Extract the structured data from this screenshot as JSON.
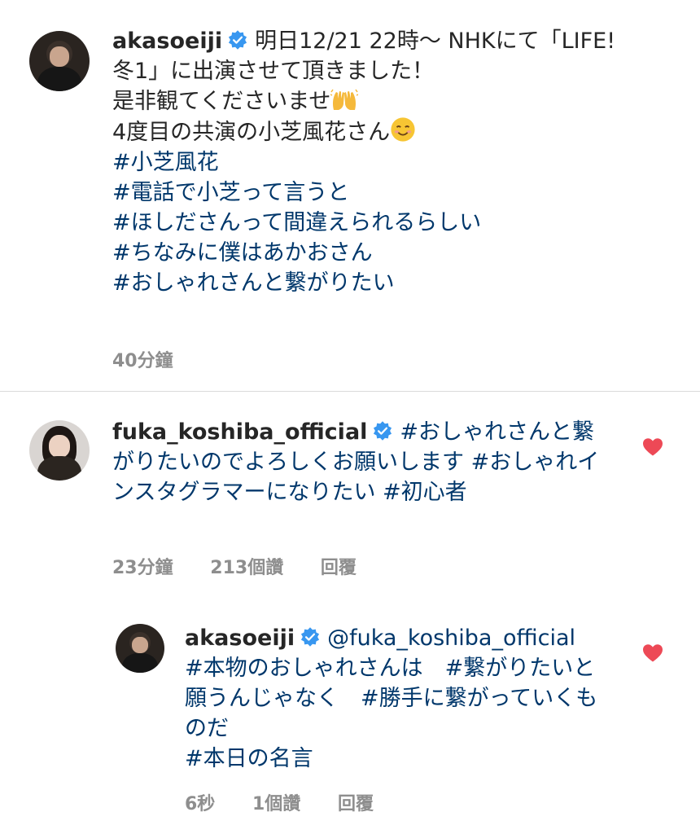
{
  "caption": {
    "username": "akasoeiji",
    "intro": "明日12/21 22時〜 NHKにて「LIFE! 冬1」に出演させて頂きました！",
    "line2": "是非観てくださいませ",
    "line3": "4度目の共演の小芝風花さん",
    "hashtags": [
      "#小芝風花",
      "#電話で小芝って言うと",
      "#ほしださんって間違えられるらしい",
      "#ちなみに僕はあかおさん",
      "#おしゃれさんと繋がりたい"
    ],
    "time": "40分鐘"
  },
  "comment": {
    "username": "fuka_koshiba_official",
    "text": "#おしゃれさんと繋がりたいのでよろしくお願いします #おしゃれインスタグラマーになりたい #初心者",
    "time": "23分鐘",
    "likes": "213個讚",
    "reply_label": "回覆",
    "liked": true,
    "heart_color": "#ed4956"
  },
  "reply": {
    "username": "akasoeiji",
    "mention": "@fuka_koshiba_official",
    "text": "#本物のおしゃれさんは　#繋がりたいと願うんじゃなく　#勝手に繋がっていくものだ",
    "last_tag": "#本日の名言",
    "time": "6秒",
    "likes": "1個讚",
    "reply_label": "回覆",
    "liked": true,
    "heart_color": "#ed4956"
  },
  "colors": {
    "verified": "#3897f0",
    "hashtag": "#00376b",
    "meta": "#8e8e8e",
    "text": "#262626",
    "divider": "#dbdbdb"
  }
}
